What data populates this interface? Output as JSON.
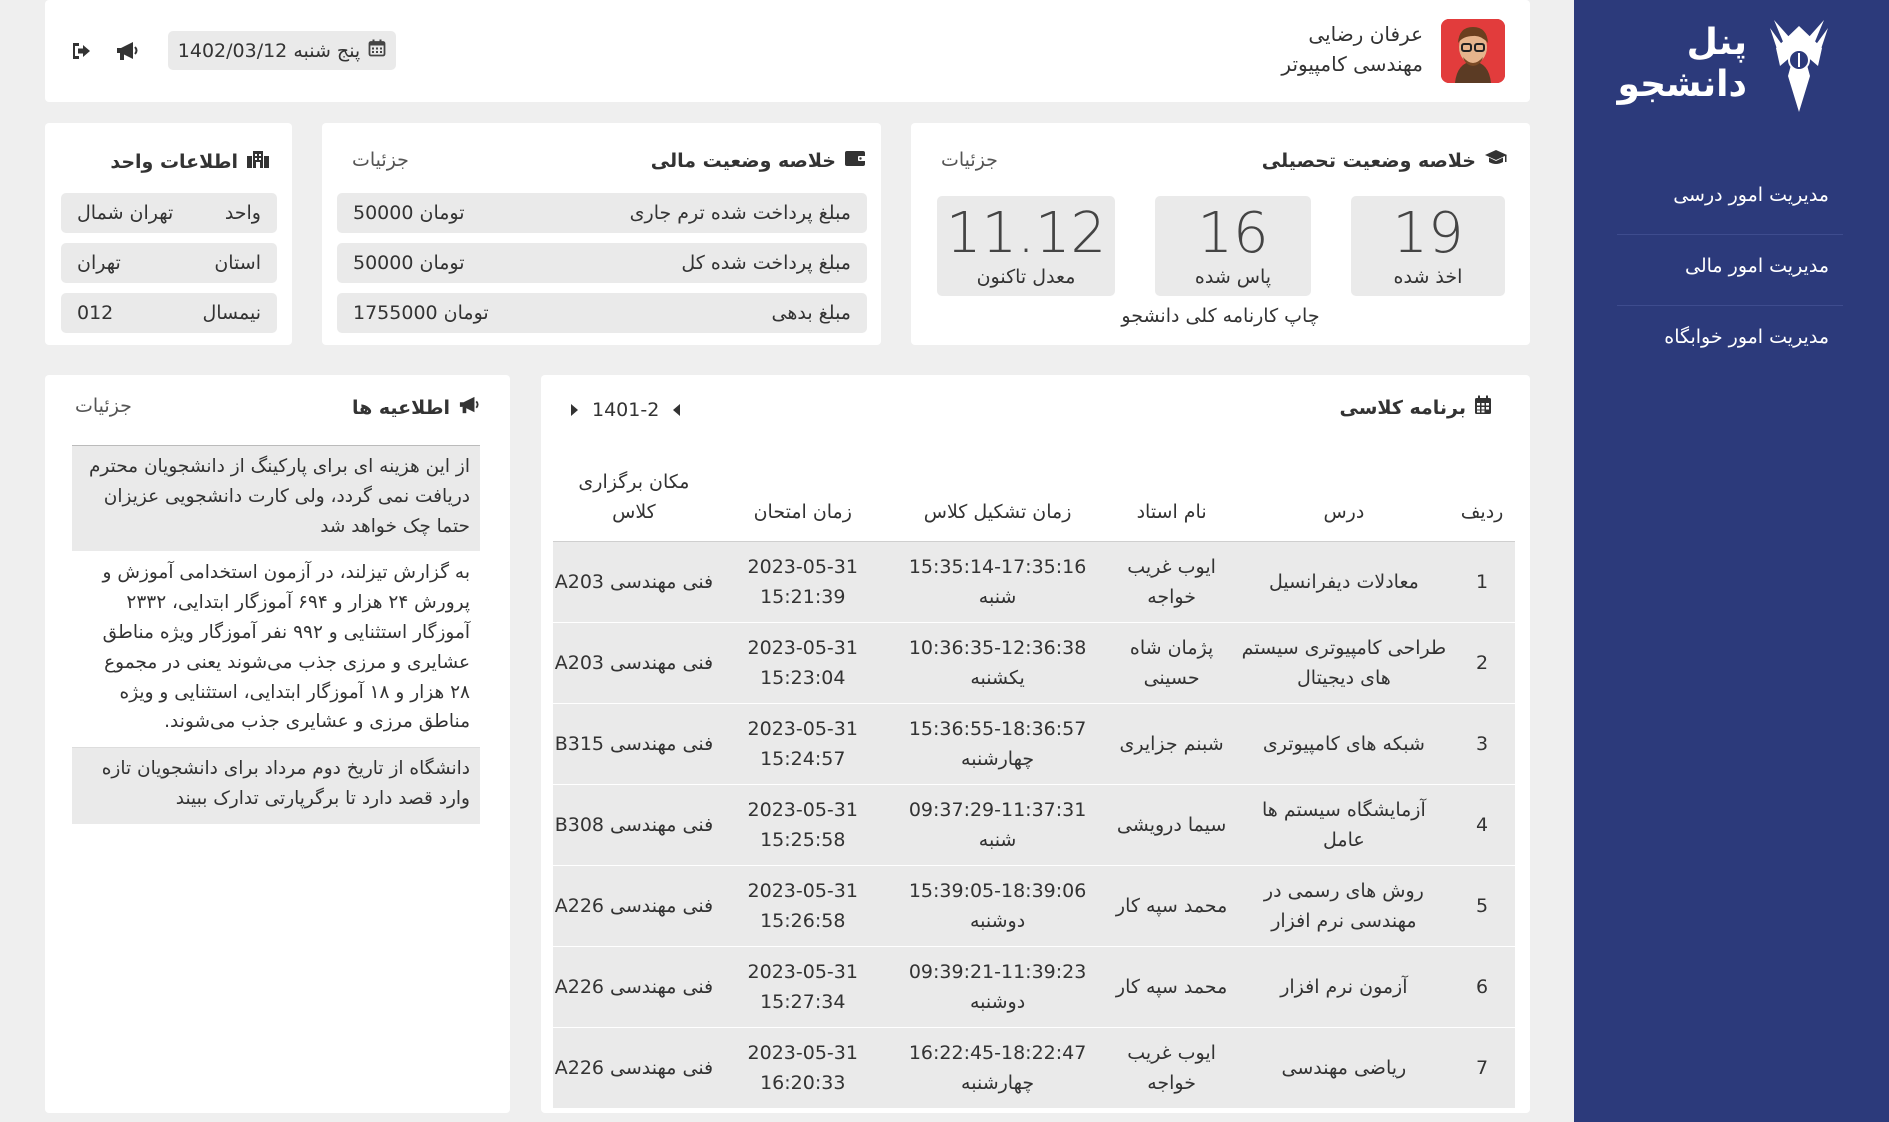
{
  "sidebar": {
    "brand_line1": "پنل",
    "brand_line2": "دانشجو",
    "items": [
      {
        "label": "مدیریت امور درسی"
      },
      {
        "label": "مدیریت امور مالی"
      },
      {
        "label": "مدیریت امور خوابگاه"
      }
    ]
  },
  "topbar": {
    "user_name": "عرفان رضایی",
    "user_major": "مهندسی کامپیوتر",
    "date": "پنج شنبه 1402/03/12"
  },
  "academic": {
    "title": "خلاصه وضعیت تحصیلی",
    "details_link": "جزئیات",
    "stats": [
      {
        "value": "19",
        "label": "اخذ شده"
      },
      {
        "value": "16",
        "label": "پاس شده"
      },
      {
        "value": "11.12",
        "label": "معدل تاکنون"
      }
    ],
    "print_link": "چاپ کارنامه کلی دانشجو"
  },
  "financial": {
    "title": "خلاصه وضعیت مالی",
    "details_link": "جزئیات",
    "rows": [
      {
        "label": "مبلغ پرداخت شده ترم جاری",
        "value": "تومان 50000"
      },
      {
        "label": "مبلغ پرداخت شده کل",
        "value": "تومان 50000"
      },
      {
        "label": "مبلغ بدهی",
        "value": "تومان 1755000"
      }
    ]
  },
  "unit": {
    "title": "اطلاعات واحد",
    "rows": [
      {
        "label": "واحد",
        "value": "تهران شمال"
      },
      {
        "label": "استان",
        "value": "تهران"
      },
      {
        "label": "نیمسال",
        "value": "012"
      }
    ]
  },
  "schedule": {
    "title": "برنامه کلاسی",
    "term": "1401-2",
    "headers": [
      "ردیف",
      "درس",
      "نام استاد",
      "زمان تشکیل کلاس",
      "زمان امتحان",
      "مکان برگزاری کلاس"
    ],
    "rows": [
      [
        "1",
        "معادلات دیفرانسیل",
        "ایوب غریب خواجه",
        "15:35:14-17:35:16 شنبه",
        "2023-05-31 15:21:39",
        "فنی مهندسی A203"
      ],
      [
        "2",
        "طراحی کامپیوتری سیستم های دیجیتال",
        "پژمان شاه حسینی",
        "10:36:35-12:36:38 یکشنبه",
        "2023-05-31 15:23:04",
        "فنی مهندسی A203"
      ],
      [
        "3",
        "شبکه های کامپیوتری",
        "شبنم جزایری",
        "15:36:55-18:36:57 چهارشنبه",
        "2023-05-31 15:24:57",
        "فنی مهندسی B315"
      ],
      [
        "4",
        "آزمایشگاه سیستم ها عامل",
        "سیما درویشی",
        "09:37:29-11:37:31 شنبه",
        "2023-05-31 15:25:58",
        "فنی مهندسی B308"
      ],
      [
        "5",
        "روش های رسمی در مهندسی نرم افزار",
        "محمد سپه کار",
        "15:39:05-18:39:06 دوشنبه",
        "2023-05-31 15:26:58",
        "فنی مهندسی A226"
      ],
      [
        "6",
        "آزمون نرم افزار",
        "محمد سپه کار",
        "09:39:21-11:39:23 دوشنبه",
        "2023-05-31 15:27:34",
        "فنی مهندسی A226"
      ],
      [
        "7",
        "ریاضی مهندسی",
        "ایوب غریب خواجه",
        "16:22:45-18:22:47 چهارشنبه",
        "2023-05-31 16:20:33",
        "فنی مهندسی A226"
      ]
    ]
  },
  "announcements": {
    "title": "اطلاعیه ها",
    "details_link": "جزئیات",
    "items": [
      "از این هزینه ای برای پارکینگ از دانشجویان محترم دریافت نمی گردد، ولی کارت دانشجویی عزیزان حتما چک خواهد شد",
      "به گزارش تیزلند، در آزمون استخدامی آموزش و پرورش ۲۴ هزار و ۶۹۴ آموزگار ابتدایی، ۲۳۳۲ آموزگار استثنایی و ۹۹۲ نفر آموزگار ویژه مناطق عشایری و مرزی جذب می‌شوند یعنی در مجموع ۲۸ هزار و ۱۸ آموزگار ابتدایی، استثنایی و ویژه مناطق مرزی و عشایری جذب می‌شوند.",
      "دانشگاه از تاریخ دوم مرداد برای دانشجویان تازه وارد قصد دارد تا برگرپارتی تدارک ببیند"
    ]
  },
  "colors": {
    "sidebar": "#2c3a7b",
    "background": "#efefef",
    "panel": "#eaeaea"
  },
  "icons": [
    "university-logo",
    "user-avatar",
    "calendar-icon",
    "megaphone-icon",
    "logout-icon",
    "graduation-cap-icon",
    "wallet-icon",
    "building-icon",
    "calendar-grid-icon",
    "chevron-left-icon",
    "chevron-right-icon"
  ]
}
